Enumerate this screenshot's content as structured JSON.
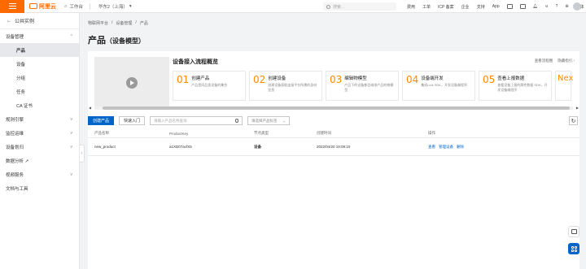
{
  "topbar": {
    "logo": "阿里云",
    "workbench": "工作台",
    "region": "华东2（上海）",
    "search_placeholder": "搜索...",
    "links": [
      "费用",
      "工单",
      "ICP 备案",
      "企业",
      "支持",
      "App"
    ],
    "user_label": "简体"
  },
  "sidebar": {
    "back_label": "公共实例",
    "items": [
      {
        "label": "设备管理",
        "type": "group",
        "chevron": "^"
      },
      {
        "label": "产品",
        "type": "item",
        "active": true
      },
      {
        "label": "设备",
        "type": "item"
      },
      {
        "label": "分组",
        "type": "item"
      },
      {
        "label": "任务",
        "type": "item"
      },
      {
        "label": "CA 证书",
        "type": "item"
      },
      {
        "label": "规则引擎",
        "type": "group",
        "chevron": "v"
      },
      {
        "label": "监控运维",
        "type": "group",
        "chevron": "v"
      },
      {
        "label": "设备划归",
        "type": "group",
        "chevron": "v"
      },
      {
        "label": "数据分析 ↗",
        "type": "group",
        "chevron": ""
      },
      {
        "label": "视频服务",
        "type": "group",
        "chevron": "v"
      },
      {
        "label": "文档与工具",
        "type": "group",
        "chevron": ""
      }
    ]
  },
  "breadcrumb": [
    "物联网平台",
    "/",
    "设备管理",
    "/",
    "产品"
  ],
  "page": {
    "title": "产品",
    "subtitle": "（设备模型）"
  },
  "guide": {
    "title": "设备接入流程概览",
    "actions": [
      "查看流程图",
      "隐藏指引 ›"
    ],
    "steps": [
      {
        "num": "01",
        "name": "创建产品",
        "desc": "产品是同品类设备的集合"
      },
      {
        "num": "02",
        "name": "创建设备",
        "desc": "创建设备获取连接平台所需的身份信息"
      },
      {
        "num": "03",
        "name": "编辑物模型",
        "desc": "产品下的设备都会继承产品的物模型"
      },
      {
        "num": "04",
        "name": "设备端开发",
        "desc": "集成Link SDK，开发设备端程序"
      },
      {
        "num": "05",
        "name": "查看上报数据",
        "desc": "查看设备上报的属性数据 SDK，开发设备端程序"
      },
      {
        "num": "Nex",
        "name": "",
        "desc": ""
      }
    ]
  },
  "toolbar": {
    "create_label": "创建产品",
    "quick_label": "快速入门",
    "search_placeholder": "请输入产品名称查询",
    "select_placeholder": "请选择产品标签"
  },
  "table": {
    "headers": [
      "产品名称",
      "ProductKey",
      "节点类型",
      "创建时间",
      "操作"
    ],
    "rows": [
      {
        "name": "new_product",
        "key": "a1XD07acfX5",
        "node": "设备",
        "created": "2022/04/20 19:09:10",
        "actions": [
          "查看",
          "管理设备",
          "删除"
        ]
      }
    ]
  }
}
